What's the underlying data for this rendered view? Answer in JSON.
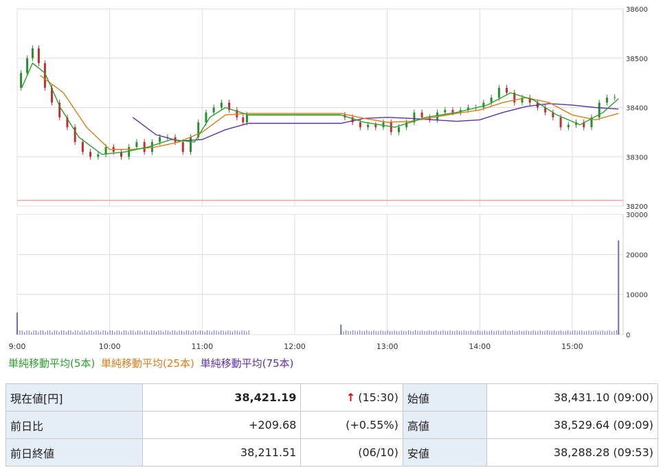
{
  "chart_data": [
    {
      "type": "line",
      "title": "",
      "x_ticks": [
        "9:00",
        "10:00",
        "11:00",
        "12:00",
        "13:00",
        "14:00",
        "15:00"
      ],
      "ylim": [
        38200,
        38600
      ],
      "y_ticks": [
        38200,
        38300,
        38400,
        38500,
        38600
      ],
      "grid": true,
      "y_axis_side": "right",
      "reference_line": {
        "value": 38211.51,
        "color": "#ff8080"
      },
      "price_series_color": {
        "up": "#2a8f2a",
        "down": "#c03030"
      },
      "price": [
        [
          "9:00",
          38440
        ],
        [
          "9:05",
          38470
        ],
        [
          "9:08",
          38500
        ],
        [
          "9:12",
          38520
        ],
        [
          "9:16",
          38490
        ],
        [
          "9:20",
          38440
        ],
        [
          "9:25",
          38410
        ],
        [
          "9:30",
          38380
        ],
        [
          "9:35",
          38360
        ],
        [
          "9:40",
          38330
        ],
        [
          "9:45",
          38310
        ],
        [
          "9:50",
          38300
        ],
        [
          "9:55",
          38305
        ],
        [
          "10:00",
          38320
        ],
        [
          "10:05",
          38310
        ],
        [
          "10:10",
          38300
        ],
        [
          "10:15",
          38320
        ],
        [
          "10:20",
          38330
        ],
        [
          "10:25",
          38310
        ],
        [
          "10:30",
          38330
        ],
        [
          "10:35",
          38340
        ],
        [
          "10:40",
          38340
        ],
        [
          "10:45",
          38330
        ],
        [
          "10:50",
          38310
        ],
        [
          "10:55",
          38340
        ],
        [
          "11:00",
          38370
        ],
        [
          "11:05",
          38390
        ],
        [
          "11:10",
          38400
        ],
        [
          "11:15",
          38410
        ],
        [
          "11:20",
          38395
        ],
        [
          "11:25",
          38380
        ],
        [
          "11:28",
          38370
        ],
        [
          "11:30",
          38385
        ],
        [
          "12:30",
          38385
        ],
        [
          "12:35",
          38380
        ],
        [
          "12:40",
          38370
        ],
        [
          "12:45",
          38360
        ],
        [
          "12:50",
          38365
        ],
        [
          "12:55",
          38360
        ],
        [
          "13:00",
          38370
        ],
        [
          "13:05",
          38350
        ],
        [
          "13:10",
          38360
        ],
        [
          "13:15",
          38370
        ],
        [
          "13:20",
          38390
        ],
        [
          "13:25",
          38380
        ],
        [
          "13:30",
          38375
        ],
        [
          "13:35",
          38390
        ],
        [
          "13:40",
          38395
        ],
        [
          "13:45",
          38390
        ],
        [
          "13:50",
          38395
        ],
        [
          "13:55",
          38400
        ],
        [
          "14:00",
          38400
        ],
        [
          "14:05",
          38410
        ],
        [
          "14:10",
          38420
        ],
        [
          "14:15",
          38440
        ],
        [
          "14:20",
          38430
        ],
        [
          "14:25",
          38410
        ],
        [
          "14:30",
          38420
        ],
        [
          "14:35",
          38410
        ],
        [
          "14:40",
          38400
        ],
        [
          "14:45",
          38390
        ],
        [
          "14:50",
          38380
        ],
        [
          "14:55",
          38360
        ],
        [
          "15:00",
          38365
        ],
        [
          "15:05",
          38370
        ],
        [
          "15:10",
          38360
        ],
        [
          "15:15",
          38380
        ],
        [
          "15:20",
          38410
        ],
        [
          "15:25",
          38420
        ],
        [
          "15:30",
          38421
        ]
      ],
      "sma5": [
        [
          "9:03",
          38440
        ],
        [
          "9:10",
          38490
        ],
        [
          "9:18",
          38470
        ],
        [
          "9:28",
          38400
        ],
        [
          "9:40",
          38340
        ],
        [
          "9:55",
          38305
        ],
        [
          "10:10",
          38310
        ],
        [
          "10:25",
          38320
        ],
        [
          "10:40",
          38335
        ],
        [
          "10:55",
          38330
        ],
        [
          "11:05",
          38380
        ],
        [
          "11:15",
          38400
        ],
        [
          "11:30",
          38385
        ],
        [
          "12:30",
          38385
        ],
        [
          "12:45",
          38370
        ],
        [
          "13:05",
          38360
        ],
        [
          "13:25",
          38380
        ],
        [
          "13:45",
          38390
        ],
        [
          "14:05",
          38405
        ],
        [
          "14:20",
          38430
        ],
        [
          "14:35",
          38415
        ],
        [
          "14:50",
          38385
        ],
        [
          "15:05",
          38365
        ],
        [
          "15:20",
          38390
        ],
        [
          "15:30",
          38418
        ]
      ],
      "sma25": [
        [
          "9:15",
          38465
        ],
        [
          "9:30",
          38430
        ],
        [
          "9:45",
          38360
        ],
        [
          "10:00",
          38315
        ],
        [
          "10:15",
          38315
        ],
        [
          "10:30",
          38320
        ],
        [
          "10:45",
          38330
        ],
        [
          "11:00",
          38350
        ],
        [
          "11:15",
          38385
        ],
        [
          "11:30",
          38388
        ],
        [
          "12:30",
          38388
        ],
        [
          "12:45",
          38378
        ],
        [
          "13:00",
          38370
        ],
        [
          "13:15",
          38372
        ],
        [
          "13:30",
          38380
        ],
        [
          "13:45",
          38388
        ],
        [
          "14:00",
          38395
        ],
        [
          "14:15",
          38410
        ],
        [
          "14:30",
          38420
        ],
        [
          "14:45",
          38410
        ],
        [
          "15:00",
          38385
        ],
        [
          "15:15",
          38375
        ],
        [
          "15:30",
          38388
        ]
      ],
      "sma75": [
        [
          "10:15",
          38380
        ],
        [
          "10:30",
          38345
        ],
        [
          "10:45",
          38332
        ],
        [
          "11:00",
          38335
        ],
        [
          "11:15",
          38355
        ],
        [
          "11:30",
          38368
        ],
        [
          "12:30",
          38368
        ],
        [
          "12:45",
          38378
        ],
        [
          "13:00",
          38380
        ],
        [
          "13:15",
          38378
        ],
        [
          "13:30",
          38375
        ],
        [
          "13:45",
          38372
        ],
        [
          "14:00",
          38375
        ],
        [
          "14:15",
          38390
        ],
        [
          "14:30",
          38402
        ],
        [
          "14:45",
          38408
        ],
        [
          "15:00",
          38405
        ],
        [
          "15:15",
          38400
        ],
        [
          "15:30",
          38397
        ]
      ]
    },
    {
      "type": "bar",
      "ylim": [
        0,
        30000
      ],
      "y_ticks": [
        0,
        10000,
        20000,
        30000
      ],
      "grid": true,
      "bar_color": "#6670b8",
      "volume_peaks": [
        [
          "9:00",
          5500
        ],
        [
          "12:30",
          2500
        ],
        [
          "15:30",
          23500
        ]
      ],
      "volume_base": 1100
    }
  ],
  "legend": {
    "sma5": "単純移動平均(5本)",
    "sma25": "単純移動平均(25本)",
    "sma75": "単純移動平均(75本)",
    "colors": {
      "sma5": "#2aa02a",
      "sma25": "#e07a1a",
      "sma75": "#5b2fa8"
    }
  },
  "table": {
    "current_label": "現在値[円]",
    "current_value": "38,421.19",
    "current_arrow": "↑",
    "current_time": "(15:30)",
    "open_label": "始値",
    "open_value": "38,431.10 (09:00)",
    "change_label": "前日比",
    "change_value": "+209.68",
    "change_pct": "(+0.55%)",
    "high_label": "高値",
    "high_value": "38,529.64 (09:09)",
    "prev_label": "前日終値",
    "prev_value": "38,211.51",
    "prev_date": "(06/10)",
    "low_label": "安値",
    "low_value": "38,288.28 (09:53)"
  }
}
